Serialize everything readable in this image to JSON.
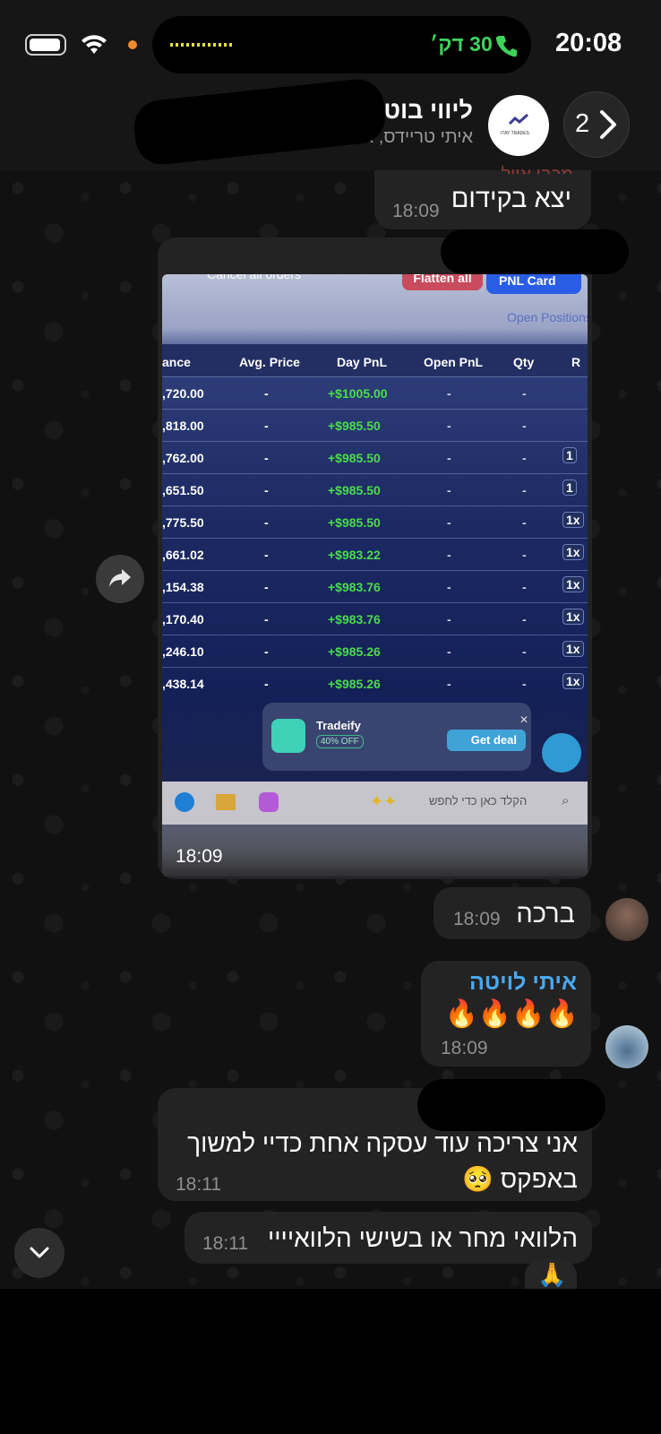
{
  "status_bar": {
    "time": "20:08",
    "call_duration": "30 דק׳"
  },
  "header": {
    "back_count": "2",
    "title": "ליווי בוט",
    "subtitle": "איתי טריידס, איתי",
    "logo_text": "ITAY TRADES"
  },
  "messages": {
    "m1": {
      "text": "יצא בקידום",
      "time": "18:09",
      "sender_partial": "מכבי אייל"
    },
    "image_msg": {
      "time": "18:09"
    },
    "m2": {
      "text": "ברכה",
      "time": "18:09"
    },
    "m3": {
      "sender": "איתי לויטה",
      "text": "🔥🔥🔥🔥",
      "time": "18:09"
    },
    "m4": {
      "text": "אני צריכה עוד עסקה אחת כדיי למשוך באפקס 🥺",
      "time": "18:11"
    },
    "m5": {
      "text": "הלוואי מחר או בשישי הלוואיייי",
      "time": "18:11",
      "reaction": "🙏"
    }
  },
  "screenshot": {
    "top_buttons": {
      "cancel_all": "Cancel all orders",
      "flatten_all": "Flatten all",
      "pnl_card": "PNL Card"
    },
    "tab_label": "Open Positions",
    "columns": [
      "ance",
      "Avg. Price",
      "Day PnL",
      "Open PnL",
      "Qty",
      "R"
    ],
    "rows": [
      {
        "balance": ",720.00",
        "avg": "-",
        "pnl": "+$1005.00",
        "open": "-",
        "qty": "-",
        "mult": ""
      },
      {
        "balance": ",818.00",
        "avg": "-",
        "pnl": "+$985.50",
        "open": "-",
        "qty": "-",
        "mult": ""
      },
      {
        "balance": ",762.00",
        "avg": "-",
        "pnl": "+$985.50",
        "open": "-",
        "qty": "-",
        "mult": "1"
      },
      {
        "balance": ",651.50",
        "avg": "-",
        "pnl": "+$985.50",
        "open": "-",
        "qty": "-",
        "mult": "1"
      },
      {
        "balance": ",775.50",
        "avg": "-",
        "pnl": "+$985.50",
        "open": "-",
        "qty": "-",
        "mult": "1x"
      },
      {
        "balance": ",661.02",
        "avg": "-",
        "pnl": "+$983.22",
        "open": "-",
        "qty": "-",
        "mult": "1x"
      },
      {
        "balance": ",154.38",
        "avg": "-",
        "pnl": "+$983.76",
        "open": "-",
        "qty": "-",
        "mult": "1x"
      },
      {
        "balance": ",170.40",
        "avg": "-",
        "pnl": "+$983.76",
        "open": "-",
        "qty": "-",
        "mult": "1x"
      },
      {
        "balance": ",246.10",
        "avg": "-",
        "pnl": "+$985.26",
        "open": "-",
        "qty": "-",
        "mult": "1x"
      },
      {
        "balance": ",438.14",
        "avg": "-",
        "pnl": "+$985.26",
        "open": "-",
        "qty": "-",
        "mult": "1x"
      }
    ],
    "ad": {
      "brand": "Tradeify",
      "discount": "40% OFF",
      "cta": "Get deal"
    },
    "taskbar_search": "הקלד כאן כדי לחפש"
  },
  "colors": {
    "bubble": "#232323",
    "sender_name": "#4aa8f0",
    "call_green": "#3ed35c",
    "pnl_green": "#4bdc4b"
  },
  "icons": [
    "battery-icon",
    "wifi-icon",
    "phone-icon",
    "chevron-right-icon",
    "forward-icon",
    "chevron-down-icon"
  ]
}
